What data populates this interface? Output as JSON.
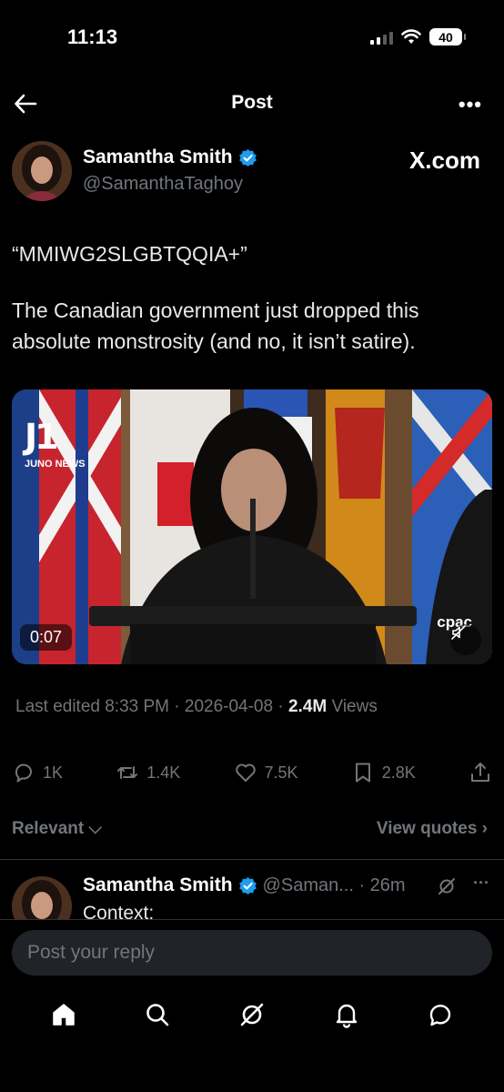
{
  "status_bar": {
    "time": "11:13",
    "battery": "40"
  },
  "header": {
    "title": "Post",
    "more": "•••"
  },
  "post": {
    "author_name": "Samantha Smith",
    "author_handle": "@SamanthaTaghoy",
    "source": "X.com",
    "text_line1": "“MMIWG2SLGBTQQIA+”",
    "text_line2": "The Canadian government just dropped this absolute monstrosity (and no, it isn’t satire).",
    "video": {
      "duration": "0:07",
      "watermark": "cpac",
      "logo_text": "JUNO NEWS",
      "logo_mark": "J1"
    },
    "meta": {
      "edited": "Last edited 8:33 PM · 2026-04-08 · ",
      "views_count": "2.4M",
      "views_label": " Views"
    }
  },
  "actions": {
    "replies": "1K",
    "reposts": "1.4K",
    "likes": "7.5K",
    "bookmarks": "2.8K"
  },
  "sort": {
    "label": "Relevant ⌵",
    "view_quotes": "View quotes ›"
  },
  "reply": {
    "author_name": "Samantha Smith",
    "handle_time": "@Saman... · 26m",
    "text": "Context:",
    "more": "···"
  },
  "composer": {
    "placeholder": "Post your reply"
  },
  "colors": {
    "accent": "#1d9bf0",
    "background": "#000000",
    "muted": "#71767b"
  },
  "icons": [
    "back-arrow-icon",
    "more-icon",
    "verified-badge-icon",
    "mute-icon",
    "reply-icon",
    "repost-icon",
    "like-icon",
    "bookmark-icon",
    "share-icon",
    "grok-icon",
    "home-icon",
    "search-icon",
    "notifications-icon",
    "messages-icon"
  ]
}
